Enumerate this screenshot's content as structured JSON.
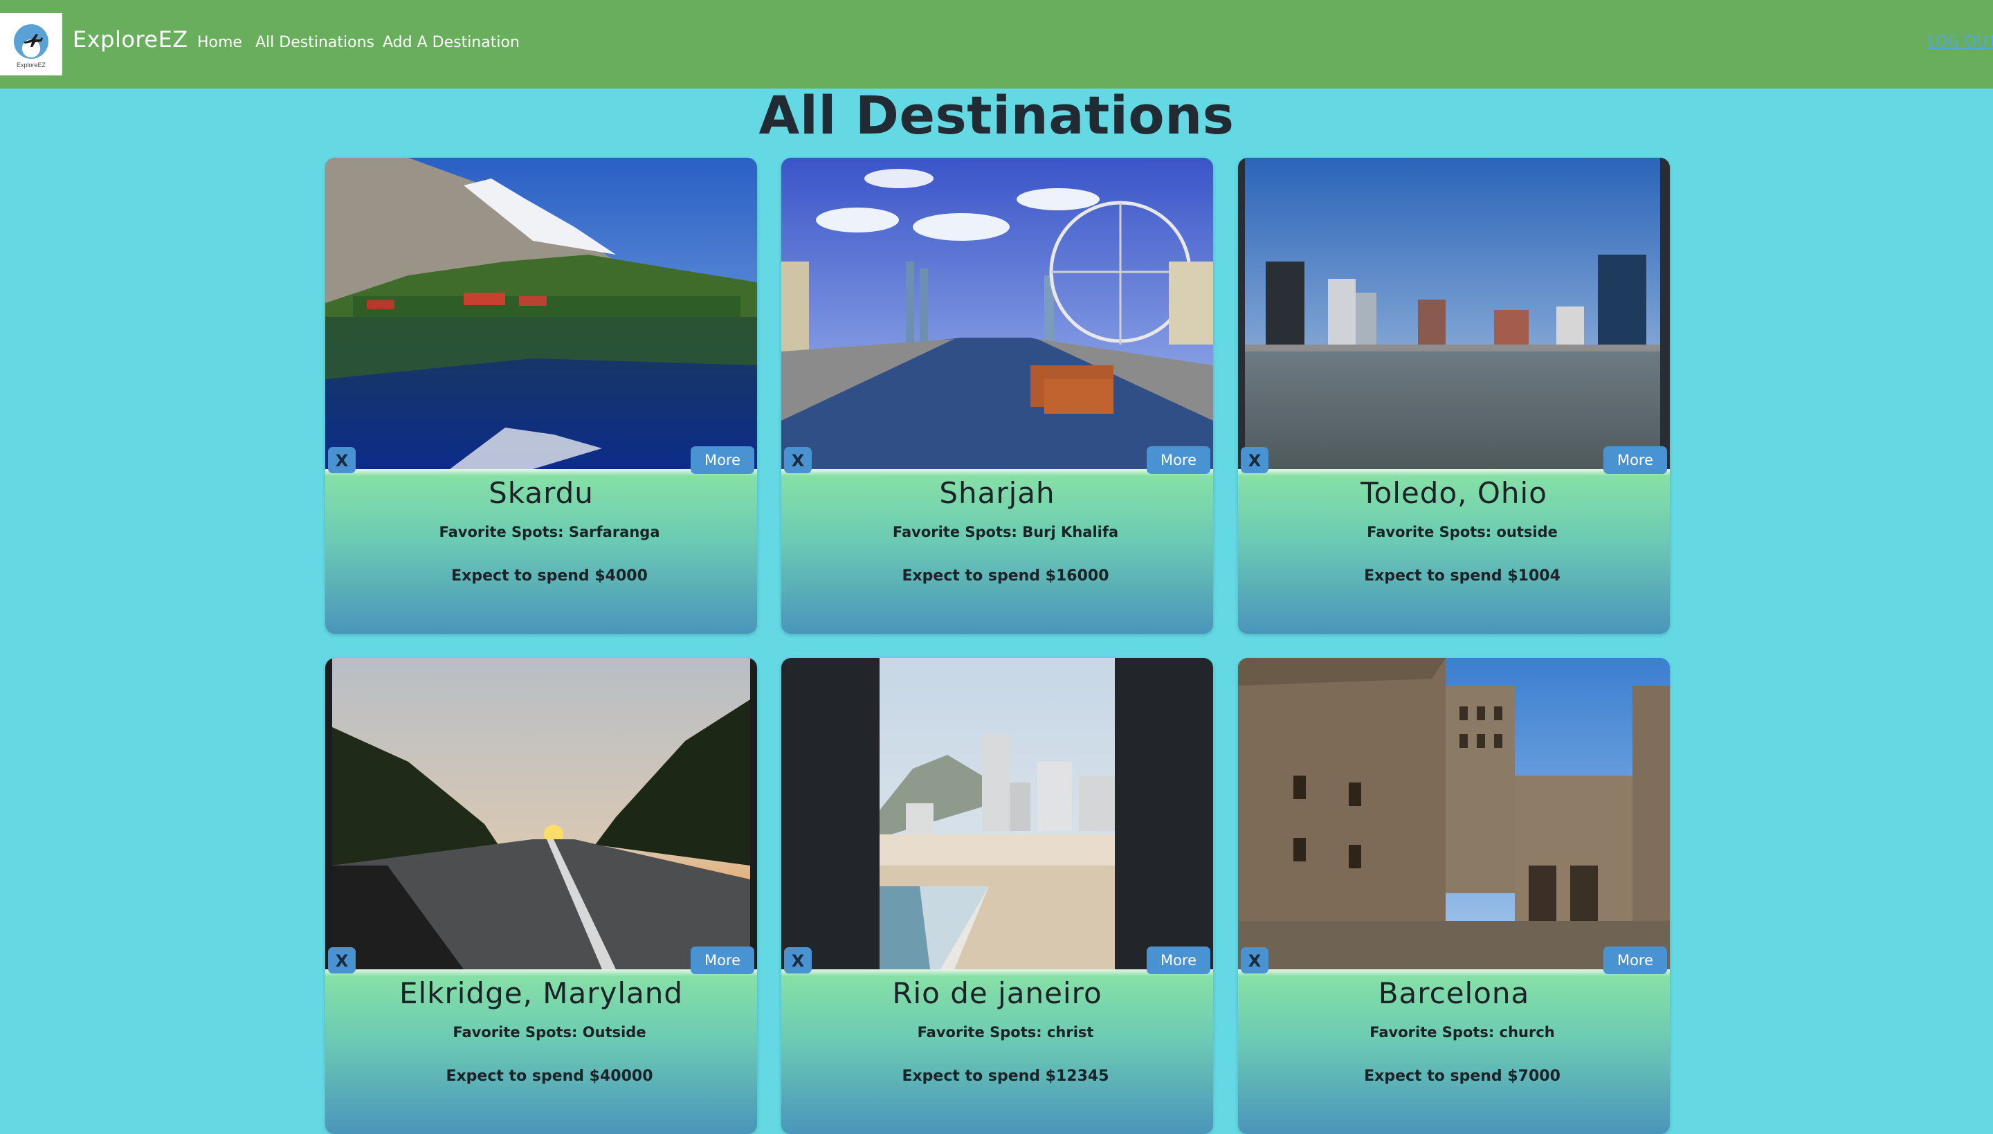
{
  "navbar": {
    "logo_text": "ExploreEZ",
    "brand": "ExploreEZ",
    "links": [
      {
        "label": "Home"
      },
      {
        "label": "All Destinations"
      },
      {
        "label": "Add A Destination"
      }
    ],
    "logout": "LOG OUT"
  },
  "page": {
    "title": "All Destinations"
  },
  "cards": [
    {
      "name": "Skardu",
      "spots": "Favorite Spots: Sarfaranga",
      "spend": "Expect to spend $4000",
      "delete_label": "X",
      "more_label": "More"
    },
    {
      "name": "Sharjah",
      "spots": "Favorite Spots: Burj Khalifa",
      "spend": "Expect to spend $16000",
      "delete_label": "X",
      "more_label": "More"
    },
    {
      "name": "Toledo, Ohio",
      "spots": "Favorite Spots: outside",
      "spend": "Expect to spend $1004",
      "delete_label": "X",
      "more_label": "More"
    },
    {
      "name": "Elkridge, Maryland",
      "spots": "Favorite Spots: Outside",
      "spend": "Expect to spend $40000",
      "delete_label": "X",
      "more_label": "More"
    },
    {
      "name": "Rio de janeiro",
      "spots": "Favorite Spots: christ",
      "spend": "Expect to spend $12345",
      "delete_label": "X",
      "more_label": "More"
    },
    {
      "name": "Barcelona",
      "spots": "Favorite Spots: church",
      "spend": "Expect to spend $7000",
      "delete_label": "X",
      "more_label": "More"
    }
  ],
  "colors": {
    "navbar": "#68ae5c",
    "background": "#64d9e4",
    "button": "#4a93d2"
  }
}
